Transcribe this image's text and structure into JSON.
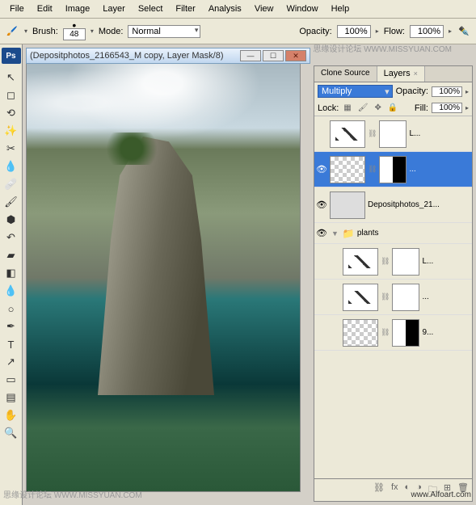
{
  "menu": {
    "file": "File",
    "edit": "Edit",
    "image": "Image",
    "layer": "Layer",
    "select": "Select",
    "filter": "Filter",
    "analysis": "Analysis",
    "view": "View",
    "window": "Window",
    "help": "Help"
  },
  "options": {
    "brush_lbl": "Brush:",
    "brush_size": "48",
    "mode_lbl": "Mode:",
    "mode": "Normal",
    "opacity_lbl": "Opacity:",
    "opacity": "100%",
    "flow_lbl": "Flow:",
    "flow": "100%"
  },
  "watermark_top": "思缘设计论坛 WWW.MISSYUAN.COM",
  "document": {
    "title": "(Depositphotos_2166543_M copy, Layer Mask/8)"
  },
  "panels": {
    "tab1": "Clone Source",
    "tab2": "Layers",
    "blend_mode": "Multiply",
    "opacity_lbl": "Opacity:",
    "opacity": "100%",
    "lock_lbl": "Lock:",
    "fill_lbl": "Fill:",
    "fill": "100%"
  },
  "layers": [
    {
      "name": "L...",
      "visible": false,
      "type": "adjustment"
    },
    {
      "name": "...",
      "visible": true,
      "type": "image-mask",
      "selected": true
    },
    {
      "name": "Depositphotos_21...",
      "visible": true,
      "type": "image"
    },
    {
      "name": "plants",
      "visible": true,
      "type": "group"
    },
    {
      "name": "L...",
      "visible": false,
      "type": "adjustment"
    },
    {
      "name": "...",
      "visible": false,
      "type": "adjustment2"
    },
    {
      "name": "9...",
      "visible": false,
      "type": "image-mask2"
    }
  ],
  "footer_url": "www.Alfoart.com",
  "bottom_brand": "思缘设计论坛 WWW.MISSYUAN.COM"
}
